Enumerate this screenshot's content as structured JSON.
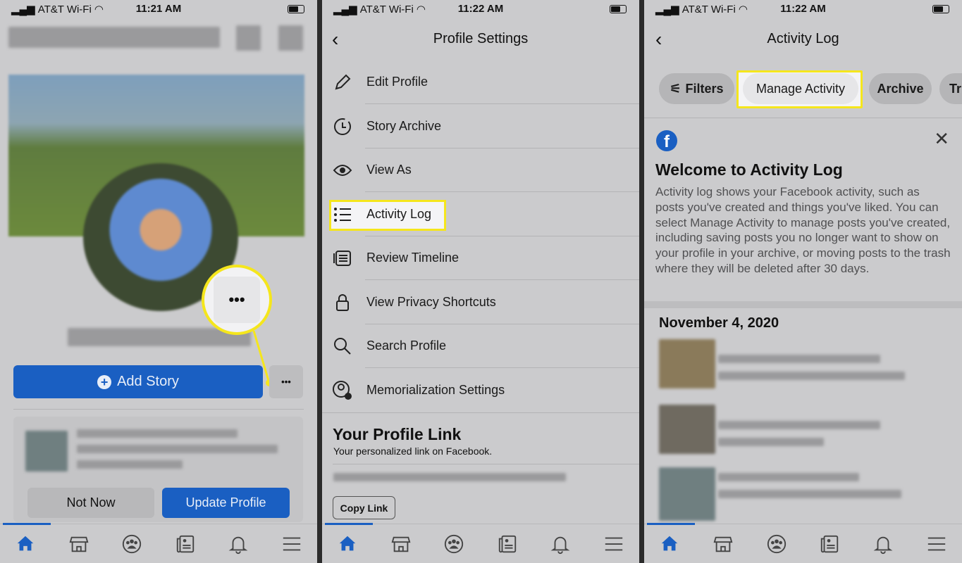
{
  "colors": {
    "accent": "#1a5fc2",
    "highlight": "#f5e61c"
  },
  "panels": [
    {
      "status": {
        "carrier": "AT&T Wi-Fi",
        "time": "11:21 AM"
      },
      "profile": {
        "add_story": "Add Story",
        "more": "•••",
        "not_now": "Not Now",
        "update_profile": "Update Profile"
      }
    },
    {
      "status": {
        "carrier": "AT&T Wi-Fi",
        "time": "11:22 AM"
      },
      "title": "Profile Settings",
      "menu": [
        {
          "label": "Edit Profile",
          "icon": "pencil-icon"
        },
        {
          "label": "Story Archive",
          "icon": "clock-icon"
        },
        {
          "label": "View As",
          "icon": "eye-icon"
        },
        {
          "label": "Activity Log",
          "icon": "list-icon"
        },
        {
          "label": "Review Timeline",
          "icon": "timeline-icon"
        },
        {
          "label": "View Privacy Shortcuts",
          "icon": "lock-icon"
        },
        {
          "label": "Search Profile",
          "icon": "search-icon"
        },
        {
          "label": "Memorialization Settings",
          "icon": "person-gear-icon"
        }
      ],
      "link_title": "Your Profile Link",
      "link_subtitle": "Your personalized link on Facebook.",
      "copy_link": "Copy Link"
    },
    {
      "status": {
        "carrier": "AT&T Wi-Fi",
        "time": "11:22 AM"
      },
      "title": "Activity Log",
      "chips": [
        "Filters",
        "Manage Activity",
        "Archive",
        "Tr"
      ],
      "welcome_title": "Welcome to Activity Log",
      "welcome_body": "Activity log shows your Facebook activity, such as posts you've created and things you've liked. You can select Manage Activity to manage posts you've created, including saving posts you no longer want to show on your profile in your archive, or moving posts to the trash where they will be deleted after 30 days.",
      "date": "November 4, 2020"
    }
  ],
  "tabbar": [
    "home-icon",
    "marketplace-icon",
    "groups-icon",
    "news-icon",
    "bell-icon",
    "menu-icon"
  ]
}
